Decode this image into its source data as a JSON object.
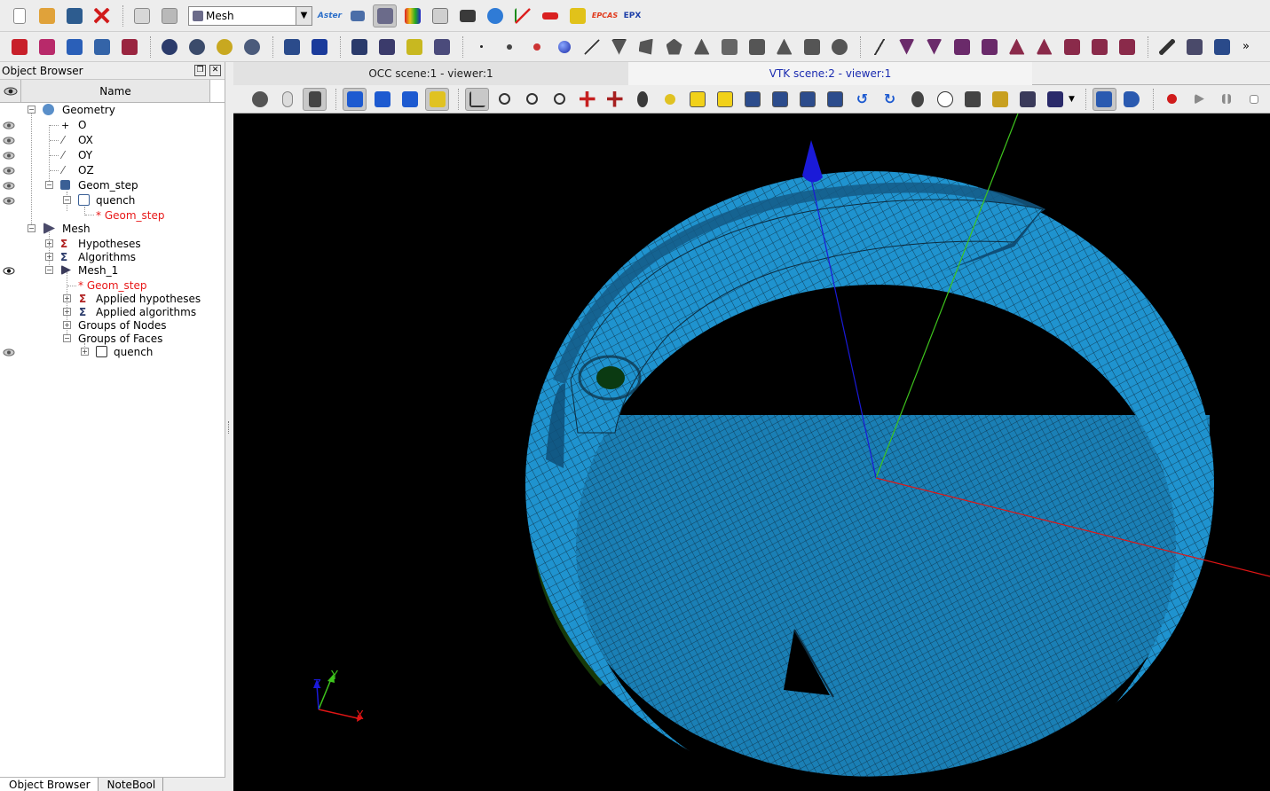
{
  "toolbar1": {
    "module_selector": {
      "value": "Mesh"
    },
    "text_icons": {
      "aster": "Aster",
      "epcas": "EPCAS",
      "epx": "EPX"
    }
  },
  "object_browser": {
    "title": "Object Browser",
    "column_name": "Name",
    "tree": {
      "geometry": "Geometry",
      "o": "O",
      "ox": "OX",
      "oy": "OY",
      "oz": "OZ",
      "geom_step": "Geom_step",
      "quench": "quench",
      "geom_step_ref": "* Geom_step",
      "mesh": "Mesh",
      "hypotheses": "Hypotheses",
      "algorithms": "Algorithms",
      "mesh_1": "Mesh_1",
      "mesh_1_geom_ref": "* Geom_step",
      "applied_hypotheses": "Applied hypotheses",
      "applied_algorithms": "Applied algorithms",
      "groups_of_nodes": "Groups of Nodes",
      "groups_of_faces": "Groups of Faces",
      "quench_group": "quench"
    },
    "bottom_tabs": {
      "object_browser": "Object Browser",
      "notebook": "NoteBool"
    }
  },
  "viewer": {
    "tabs": {
      "occ": "OCC scene:1 - viewer:1",
      "vtk": "VTK scene:2 - viewer:1"
    },
    "trihedron": {
      "x": "X",
      "y": "Y",
      "z": "Z"
    }
  },
  "colors": {
    "mesh_face": "#1f93cf",
    "mesh_edge": "#0d2c3f",
    "mesh_side": "#1a7fb5",
    "background": "#000000",
    "axis_x": "#e01515",
    "axis_y": "#3ec41d",
    "axis_z": "#1a1ad8",
    "selected_text": "#e81818"
  }
}
